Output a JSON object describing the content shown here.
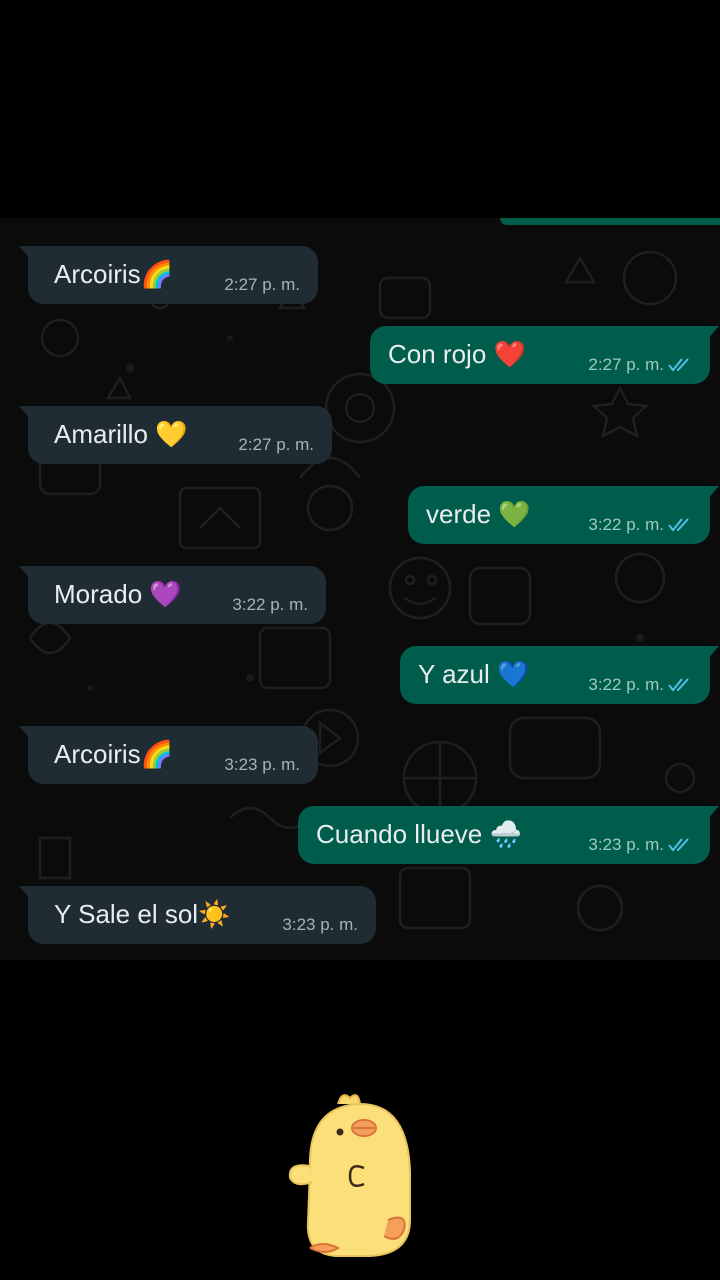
{
  "messages": [
    {
      "direction": "in",
      "text": "Arcoiris",
      "emoji": "🌈",
      "time": "2:27 p. m."
    },
    {
      "direction": "out",
      "text": "Con rojo",
      "emoji": "❤️",
      "time": "2:27 p. m.",
      "read": true
    },
    {
      "direction": "in",
      "text": "Amarillo",
      "emoji": "💛",
      "time": "2:27 p. m."
    },
    {
      "direction": "out",
      "text": "verde",
      "emoji": "💚",
      "time": "3:22 p. m.",
      "read": true
    },
    {
      "direction": "in",
      "text": "Morado",
      "emoji": "💜",
      "time": "3:22 p. m."
    },
    {
      "direction": "out",
      "text": "Y azul",
      "emoji": "💙",
      "time": "3:22 p. m.",
      "read": true
    },
    {
      "direction": "in",
      "text": "Arcoiris",
      "emoji": "🌈",
      "time": "3:23 p. m."
    },
    {
      "direction": "out",
      "text": "Cuando llueve",
      "emoji": "🌧️",
      "time": "3:23 p. m.",
      "read": true
    },
    {
      "direction": "in",
      "text": "Y Sale el sol",
      "emoji": "☀️",
      "time": "3:23 p. m."
    }
  ],
  "colors": {
    "incoming_bubble": "#202c33",
    "outgoing_bubble": "#005c4b",
    "read_ticks": "#53bdeb",
    "background": "#000000"
  },
  "icons": {
    "read_receipt": "double-check-icon",
    "sticker": "yellow-chick-sticker"
  }
}
